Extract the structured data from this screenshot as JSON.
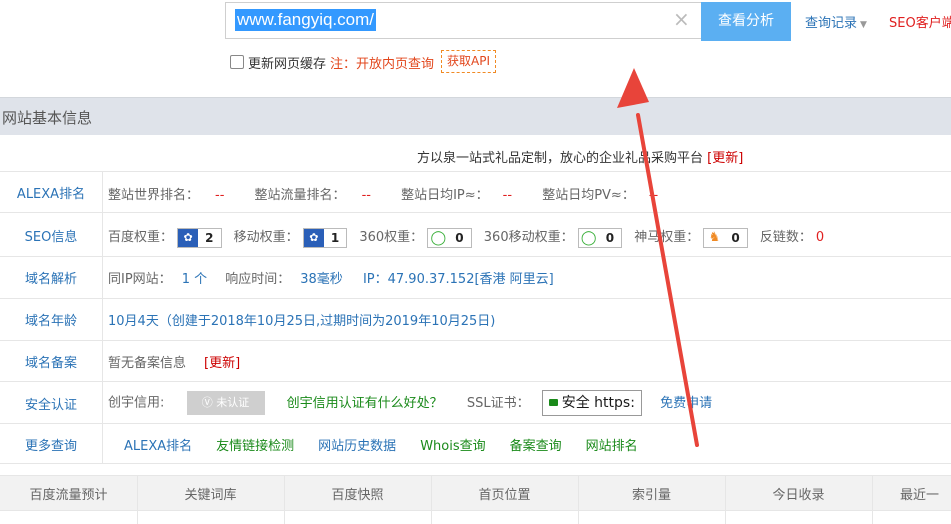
{
  "search": {
    "value": "www.fangyiq.com/",
    "analyze_label": "查看分析",
    "history_label": "查询记录",
    "seo_client_label": "SEO客户端"
  },
  "options": {
    "refresh_cache_label": "更新网页缓存",
    "note": "注：开放内页查询",
    "api_label": "获取API"
  },
  "section": {
    "title": "网站基本信息",
    "description": "方以泉一站式礼品定制，放心的企业礼品采购平台",
    "update_label": "[更新]"
  },
  "alexa": {
    "label": "ALEXA排名",
    "world_rank_label": "整站世界排名：",
    "world_rank_value": "--",
    "traffic_rank_label": "整站流量排名：",
    "traffic_rank_value": "--",
    "daily_ip_label": "整站日均IP≈：",
    "daily_ip_value": "--",
    "daily_pv_label": "整站日均PV≈：",
    "daily_pv_value": "--"
  },
  "seo": {
    "label": "SEO信息",
    "baidu_label": "百度权重：",
    "baidu_value": "2",
    "mobile_label": "移动权重：",
    "mobile_value": "1",
    "s360_label": "360权重：",
    "s360_value": "0",
    "s360m_label": "360移动权重：",
    "s360m_value": "0",
    "shenma_label": "神马权重：",
    "shenma_value": "0",
    "backlinks_label": "反链数：",
    "backlinks_value": "0"
  },
  "dns": {
    "label": "域名解析",
    "same_ip_label": "同IP网站：",
    "same_ip_value": "1 个",
    "response_label": "响应时间：",
    "response_value": "38毫秒",
    "ip_label": "IP：",
    "ip_value": "47.90.37.152[香港 阿里云]"
  },
  "age": {
    "label": "域名年龄",
    "value": "10月4天（创建于2018年10月25日,过期时间为2019年10月25日)"
  },
  "icp": {
    "label": "域名备案",
    "value": "暂无备案信息",
    "update_label": "[更新]"
  },
  "security": {
    "label": "安全认证",
    "trust_label": "创宇信用:",
    "trust_badge": "未认证",
    "trust_link": "创宇信用认证有什么好处？",
    "ssl_label": "SSL证书：",
    "ssl_badge": "安全 https:",
    "ssl_apply": "免费申请"
  },
  "more": {
    "label": "更多查询",
    "links": [
      "ALEXA排名",
      "友情链接检测",
      "网站历史数据",
      "Whois查询",
      "备案查询",
      "网站排名"
    ]
  },
  "table_header": [
    "百度流量预计",
    "关键词库",
    "百度快照",
    "首页位置",
    "索引量",
    "今日收录",
    "最近一"
  ],
  "colors": {
    "accent": "#5baff2",
    "link": "#2b73b6",
    "warn": "#e02020",
    "arrow": "#e8443a"
  }
}
